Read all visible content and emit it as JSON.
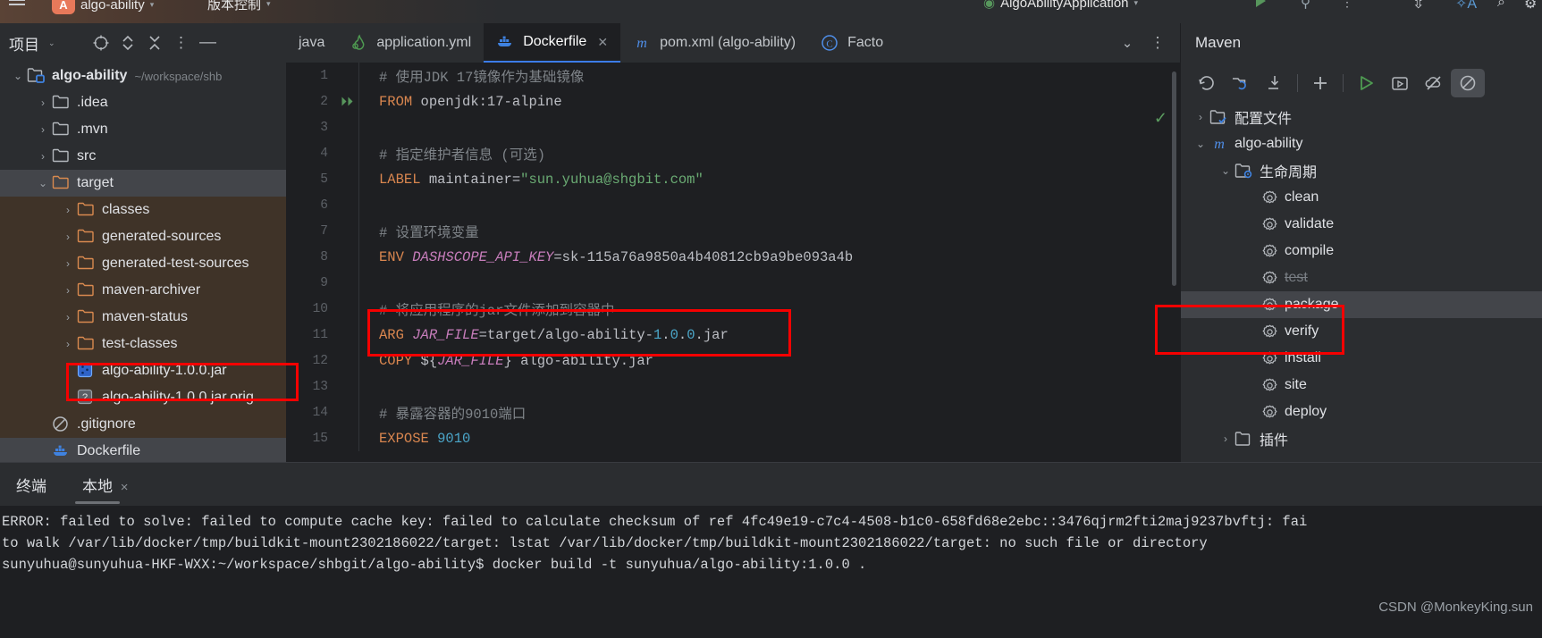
{
  "topbar": {
    "project_name": "algo-ability",
    "project_badge": "A",
    "menu_label": "版本控制",
    "run_config": "AlgoAbilityApplication"
  },
  "project_panel": {
    "title": "项目",
    "icons": [
      "locate-icon",
      "expand-collapse-icon",
      "collapse-all-icon",
      "more-options-icon",
      "minimize-icon"
    ],
    "tree": [
      {
        "label": "algo-ability",
        "sub": "~/workspace/shb",
        "icon": "module-folder-icon",
        "arrow": "down",
        "indent": 0,
        "bold": true
      },
      {
        "label": ".idea",
        "sub": "",
        "icon": "folder-icon",
        "arrow": "right",
        "indent": 1
      },
      {
        "label": ".mvn",
        "sub": "",
        "icon": "folder-icon",
        "arrow": "right",
        "indent": 1
      },
      {
        "label": "src",
        "sub": "",
        "icon": "folder-icon",
        "arrow": "right",
        "indent": 1
      },
      {
        "label": "target",
        "sub": "",
        "icon": "folder-orange-icon",
        "arrow": "down",
        "indent": 1,
        "selected": true
      },
      {
        "label": "classes",
        "sub": "",
        "icon": "folder-orange-icon",
        "arrow": "right",
        "indent": 2
      },
      {
        "label": "generated-sources",
        "sub": "",
        "icon": "folder-orange-icon",
        "arrow": "right",
        "indent": 2
      },
      {
        "label": "generated-test-sources",
        "sub": "",
        "icon": "folder-orange-icon",
        "arrow": "right",
        "indent": 2
      },
      {
        "label": "maven-archiver",
        "sub": "",
        "icon": "folder-orange-icon",
        "arrow": "right",
        "indent": 2
      },
      {
        "label": "maven-status",
        "sub": "",
        "icon": "folder-orange-icon",
        "arrow": "right",
        "indent": 2
      },
      {
        "label": "test-classes",
        "sub": "",
        "icon": "folder-orange-icon",
        "arrow": "right",
        "indent": 2
      },
      {
        "label": "algo-ability-1.0.0.jar",
        "sub": "",
        "icon": "jar-file-icon",
        "arrow": "none",
        "indent": 2,
        "highlighted": true
      },
      {
        "label": "algo-ability-1.0.0.jar.orig",
        "sub": "",
        "icon": "unknown-file-icon",
        "arrow": "none",
        "indent": 2
      },
      {
        "label": ".gitignore",
        "sub": "",
        "icon": "gitignore-icon",
        "arrow": "none",
        "indent": 1
      },
      {
        "label": "Dockerfile",
        "sub": "",
        "icon": "docker-icon",
        "arrow": "none",
        "indent": 1,
        "selected": true
      }
    ]
  },
  "editor": {
    "tabs": [
      {
        "label": "java",
        "icon": "",
        "active": false,
        "closable": false
      },
      {
        "label": "application.yml",
        "icon": "yaml-icon",
        "active": false,
        "closable": false
      },
      {
        "label": "Dockerfile",
        "icon": "docker-icon",
        "active": true,
        "closable": true
      },
      {
        "label": "pom.xml (algo-ability)",
        "icon": "maven-m-icon",
        "active": false,
        "closable": false
      },
      {
        "label": "Facto",
        "icon": "class-c-icon",
        "active": false,
        "closable": false
      }
    ],
    "tabbar_icons": [
      "chevron-down-icon",
      "more-options-icon"
    ],
    "inspection_status": "ok",
    "lines": [
      {
        "n": "1",
        "run": false,
        "tokens": [
          {
            "t": "cmt",
            "v": "# 使用JDK 17镜像作为基础镜像"
          }
        ]
      },
      {
        "n": "2",
        "run": true,
        "tokens": [
          {
            "t": "kw",
            "v": "FROM"
          },
          {
            "t": "txt",
            "v": " openjdk:17-alpine"
          }
        ]
      },
      {
        "n": "3",
        "run": false,
        "tokens": []
      },
      {
        "n": "4",
        "run": false,
        "tokens": [
          {
            "t": "cmt",
            "v": "# 指定维护者信息 (可选)"
          }
        ]
      },
      {
        "n": "5",
        "run": false,
        "tokens": [
          {
            "t": "kw",
            "v": "LABEL"
          },
          {
            "t": "txt",
            "v": " maintainer="
          },
          {
            "t": "str",
            "v": "\"sun.yuhua@shgbit.com\""
          }
        ]
      },
      {
        "n": "6",
        "run": false,
        "tokens": []
      },
      {
        "n": "7",
        "run": false,
        "tokens": [
          {
            "t": "cmt",
            "v": "# 设置环境变量"
          }
        ]
      },
      {
        "n": "8",
        "run": false,
        "tokens": [
          {
            "t": "kw",
            "v": "ENV"
          },
          {
            "t": "txt",
            "v": " "
          },
          {
            "t": "var",
            "v": "DASHSCOPE_API_KEY"
          },
          {
            "t": "txt",
            "v": "=sk-115a76a9850a4b40812cb9a9be093a4b"
          }
        ]
      },
      {
        "n": "9",
        "run": false,
        "tokens": []
      },
      {
        "n": "10",
        "run": false,
        "tokens": [
          {
            "t": "cmt",
            "v": "# 将应用程序的jar文件添加到容器中"
          }
        ]
      },
      {
        "n": "11",
        "run": false,
        "tokens": [
          {
            "t": "kw",
            "v": "ARG"
          },
          {
            "t": "txt",
            "v": " "
          },
          {
            "t": "var",
            "v": "JAR_FILE"
          },
          {
            "t": "txt",
            "v": "=target/algo-ability-"
          },
          {
            "t": "num",
            "v": "1"
          },
          {
            "t": "txt",
            "v": "."
          },
          {
            "t": "num",
            "v": "0"
          },
          {
            "t": "txt",
            "v": "."
          },
          {
            "t": "num",
            "v": "0"
          },
          {
            "t": "txt",
            "v": ".jar"
          }
        ]
      },
      {
        "n": "12",
        "run": false,
        "tokens": [
          {
            "t": "kw",
            "v": "COPY"
          },
          {
            "t": "txt",
            "v": " ${"
          },
          {
            "t": "var",
            "v": "JAR_FILE"
          },
          {
            "t": "txt",
            "v": "} algo-ability.jar"
          }
        ]
      },
      {
        "n": "13",
        "run": false,
        "tokens": []
      },
      {
        "n": "14",
        "run": false,
        "tokens": [
          {
            "t": "cmt",
            "v": "# 暴露容器的9010端口"
          }
        ]
      },
      {
        "n": "15",
        "run": false,
        "tokens": [
          {
            "t": "kw",
            "v": "EXPOSE"
          },
          {
            "t": "txt",
            "v": " "
          },
          {
            "t": "num",
            "v": "9010"
          }
        ]
      }
    ]
  },
  "maven": {
    "title": "Maven",
    "toolbar_icons": [
      "reload-all-icon",
      "reload-project-icon",
      "download-sources-icon",
      "add-icon",
      "run-icon",
      "run-config-icon",
      "toggle-offline-icon",
      "skip-tests-icon"
    ],
    "tree": [
      {
        "label": "配置文件",
        "icon": "profiles-folder-icon",
        "arrow": "right",
        "indent": 0
      },
      {
        "label": "algo-ability",
        "icon": "maven-m-icon",
        "arrow": "down",
        "indent": 0
      },
      {
        "label": "生命周期",
        "icon": "lifecycle-folder-icon",
        "arrow": "down",
        "indent": 1
      },
      {
        "label": "clean",
        "icon": "gear-icon",
        "arrow": "none",
        "indent": 2
      },
      {
        "label": "validate",
        "icon": "gear-icon",
        "arrow": "none",
        "indent": 2
      },
      {
        "label": "compile",
        "icon": "gear-icon",
        "arrow": "none",
        "indent": 2
      },
      {
        "label": "test",
        "icon": "gear-icon",
        "arrow": "none",
        "indent": 2,
        "strike": true
      },
      {
        "label": "package",
        "icon": "gear-icon",
        "arrow": "none",
        "indent": 2,
        "selected": true,
        "highlighted": true
      },
      {
        "label": "verify",
        "icon": "gear-icon",
        "arrow": "none",
        "indent": 2
      },
      {
        "label": "install",
        "icon": "gear-icon",
        "arrow": "none",
        "indent": 2
      },
      {
        "label": "site",
        "icon": "gear-icon",
        "arrow": "none",
        "indent": 2
      },
      {
        "label": "deploy",
        "icon": "gear-icon",
        "arrow": "none",
        "indent": 2
      },
      {
        "label": "插件",
        "icon": "plugins-folder-icon",
        "arrow": "right",
        "indent": 1
      }
    ]
  },
  "terminal": {
    "title": "终端",
    "session_tab": "本地",
    "close_label": "×",
    "lines": [
      "ERROR: failed to solve: failed to compute cache key: failed to calculate checksum of ref 4fc49e19-c7c4-4508-b1c0-658fd68e2ebc::3476qjrm2fti2maj9237bvftj: fai",
      "to walk /var/lib/docker/tmp/buildkit-mount2302186022/target: lstat /var/lib/docker/tmp/buildkit-mount2302186022/target: no such file or directory",
      "sunyuhua@sunyuhua-HKF-WXX:~/workspace/shbgit/algo-ability$ docker build -t sunyuhua/algo-ability:1.0.0 ."
    ]
  },
  "watermark": "CSDN @MonkeyKing.sun",
  "colors": {
    "accent_blue": "#3c7ce8",
    "annotation_red": "#f50000",
    "panel_bg": "#2b2d30",
    "editor_bg": "#1e1f22",
    "selected_row": "#43454a",
    "target_folder_bg": "#3f3328"
  }
}
